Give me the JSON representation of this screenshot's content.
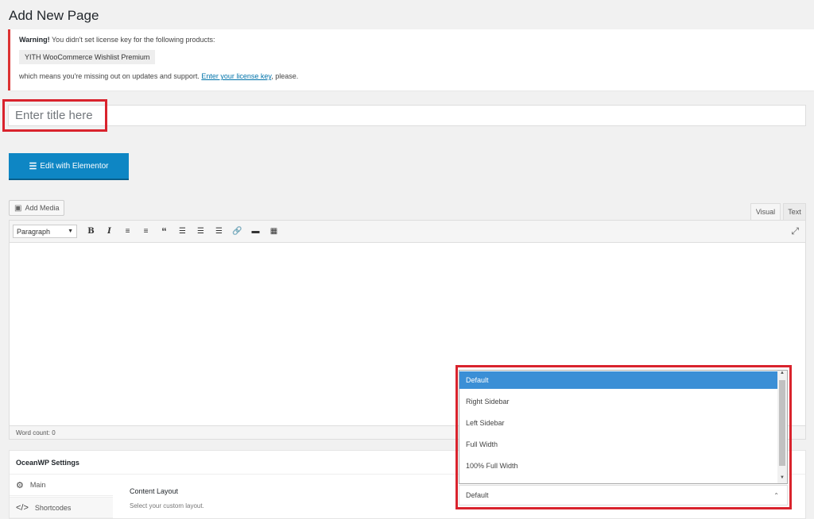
{
  "page": {
    "title": "Add New Page"
  },
  "notice": {
    "warning_label": "Warning!",
    "warning_text": " You didn't set license key for the following products:",
    "product": "YITH WooCommerce Wishlist Premium",
    "missing_text": "which means you're missing out on updates and support. ",
    "license_link": "Enter your license key",
    "please": ", please."
  },
  "title_field": {
    "placeholder": "Enter title here",
    "value": ""
  },
  "elementor": {
    "label": "Edit with Elementor",
    "icon": "elementor-icon"
  },
  "media": {
    "label": "Add Media",
    "icon": "add-media-icon"
  },
  "editor_tabs": {
    "visual": "Visual",
    "text": "Text"
  },
  "toolbar": {
    "format": "Paragraph",
    "icons": [
      "bold-icon",
      "italic-icon",
      "bullet-list-icon",
      "numbered-list-icon",
      "blockquote-icon",
      "align-left-icon",
      "align-center-icon",
      "align-right-icon",
      "link-icon",
      "read-more-icon",
      "toolbar-toggle-icon"
    ],
    "bold": "B",
    "italic": "I"
  },
  "status": {
    "word_count": "Word count: 0"
  },
  "oceanwp": {
    "title": "OceanWP Settings",
    "tabs": {
      "main": "Main",
      "shortcodes": "Shortcodes"
    },
    "content_layout": {
      "label": "Content Layout",
      "description": "Select your custom layout."
    }
  },
  "layout_dropdown": {
    "options": [
      "Default",
      "Right Sidebar",
      "Left Sidebar",
      "Full Width",
      "100% Full Width"
    ],
    "selected": "Default",
    "current_value": "Default"
  },
  "colors": {
    "highlight": "#d9232d",
    "primary_button": "#0e86c4",
    "selected_option": "#3b8fd6",
    "notice_border": "#dc3232"
  }
}
